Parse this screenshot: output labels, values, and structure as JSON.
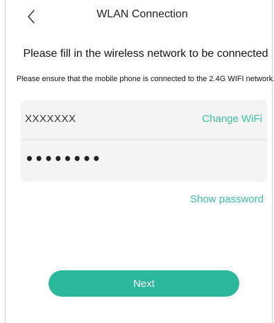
{
  "header": {
    "title": "WLAN Connection",
    "back_icon": "chevron-left-icon"
  },
  "instructions": {
    "headline": "Please fill in the wireless network to be connected",
    "note": "Please ensure that the mobile phone is connected to the 2.4G WIFI network."
  },
  "wifi_form": {
    "ssid_value": "XXXXXXX",
    "change_wifi_label": "Change WiFi",
    "password_value": "••••••••",
    "show_password_label": "Show password"
  },
  "actions": {
    "next_label": "Next"
  },
  "colors": {
    "accent": "#3bbfa0",
    "button": "#2bb89a",
    "panel": "#f4f4f4"
  }
}
